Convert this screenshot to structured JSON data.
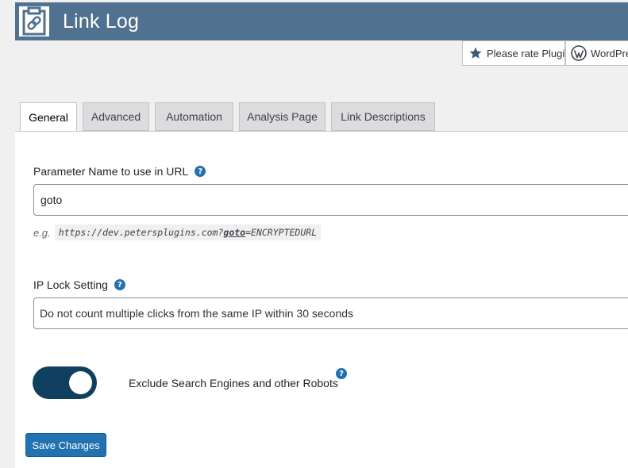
{
  "header": {
    "title": "Link Log",
    "logo_icon": "clipboard-link-icon",
    "background": "#50718f"
  },
  "top_links": {
    "rate": {
      "label": "Please rate Plugin",
      "icon": "star-icon"
    },
    "wordpress": {
      "label": "WordPress",
      "icon": "wordpress-icon"
    }
  },
  "tabs": [
    {
      "label": "General",
      "active": true
    },
    {
      "label": "Advanced",
      "active": false
    },
    {
      "label": "Automation",
      "active": false
    },
    {
      "label": "Analysis Page",
      "active": false
    },
    {
      "label": "Link Descriptions",
      "active": false
    }
  ],
  "settings": {
    "parameter": {
      "label": "Parameter Name to use in URL",
      "value": "goto",
      "example_prefix": "e.g.",
      "example_base": "https://dev.petersplugins.com?",
      "example_param": "goto",
      "example_suffix": "=ENCRYPTEDURL"
    },
    "ip_lock": {
      "label": "IP Lock Setting",
      "selected": "Do not count multiple clicks from the same IP within 30 seconds"
    },
    "exclude_robots": {
      "label": "Exclude Search Engines and other Robots",
      "enabled": true
    },
    "help_glyph": "?"
  },
  "actions": {
    "save_label": "Save Changes"
  },
  "colors": {
    "accent": "#2271b1",
    "toggle_on": "#104060"
  }
}
